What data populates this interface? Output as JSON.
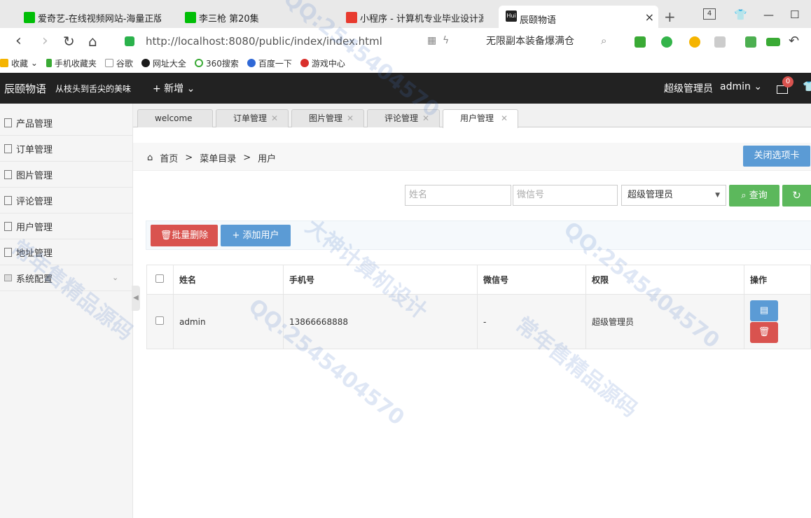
{
  "browser": {
    "tabs": [
      {
        "label": "爱奇艺-在线视频网站-海量正版高",
        "favicon_color": "#00be06"
      },
      {
        "label": "李三枪 第20集",
        "favicon_color": "#00be06"
      },
      {
        "label": "小程序 - 计算机专业毕业设计源",
        "favicon_color": "#e83a2e"
      },
      {
        "label": "辰颐物语",
        "favicon_color": "#222222",
        "favicon_text": "Hui"
      }
    ],
    "tab_count": "4",
    "url": "http://localhost:8080/public/index/index.html",
    "search_text": "无限副本装备爆满仓",
    "bookmarks": [
      "收藏",
      "手机收藏夹",
      "谷歌",
      "网址大全",
      "360搜索",
      "百度一下",
      "游戏中心"
    ]
  },
  "app": {
    "title": "辰颐物语",
    "slogan": "从枝头到舌尖的美味",
    "new_menu": "+ 新增 ⌄",
    "role": "超级管理员",
    "username": "admin ⌄",
    "mail_badge": "0"
  },
  "sidebar": {
    "items": [
      {
        "label": "产品管理"
      },
      {
        "label": "订单管理"
      },
      {
        "label": "图片管理"
      },
      {
        "label": "评论管理"
      },
      {
        "label": "用户管理"
      },
      {
        "label": "地址管理"
      },
      {
        "label": "系统配置"
      }
    ]
  },
  "content_tabs": [
    "welcome",
    "订单管理",
    "图片管理",
    "评论管理",
    "用户管理"
  ],
  "breadcrumb": {
    "home": "首页",
    "sep": ">",
    "catalog": "菜单目录",
    "current": "用户"
  },
  "close_tab_button": "关闭选项卡",
  "search": {
    "name_placeholder": "姓名",
    "wechat_placeholder": "微信号",
    "role_selected": "超级管理员",
    "query_button": "查询"
  },
  "toolbar": {
    "batch_delete": "批量删除",
    "add_user": "+ 添加用户"
  },
  "table": {
    "headers": [
      "姓名",
      "手机号",
      "微信号",
      "权限",
      "操作"
    ],
    "rows": [
      {
        "name": "admin",
        "phone": "13866668888",
        "wechat": "-",
        "role": "超级管理员"
      }
    ]
  },
  "watermark": [
    "大神计算机设计",
    "QQ:2545404570",
    "常年售精品源码"
  ]
}
